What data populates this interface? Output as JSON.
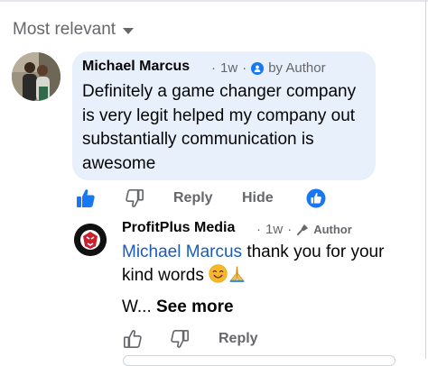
{
  "sort": {
    "label": "Most relevant",
    "icon": "caret-down-icon"
  },
  "comment": {
    "author": "Michael Marcus",
    "time": "1w",
    "separator": "·",
    "author_badge": "by Author",
    "text": "Definitely a game changer company is very legit helped my company out substantially communication is awesome",
    "actions": {
      "reply": "Reply",
      "hide": "Hide"
    },
    "reactions": [
      "like"
    ]
  },
  "reply": {
    "author": "ProfitPlus Media",
    "time": "1w",
    "separator": "·",
    "author_badge": "Author",
    "mention": "Michael Marcus",
    "text_after_mention": " thank you for your kind words ",
    "truncated": "W... ",
    "see_more": "See more",
    "actions": {
      "reply": "Reply"
    }
  },
  "colors": {
    "accent": "#1877f2",
    "bubble": "#e7f0fb",
    "secondary_text": "#65676b",
    "mention": "#1a5cb8"
  }
}
